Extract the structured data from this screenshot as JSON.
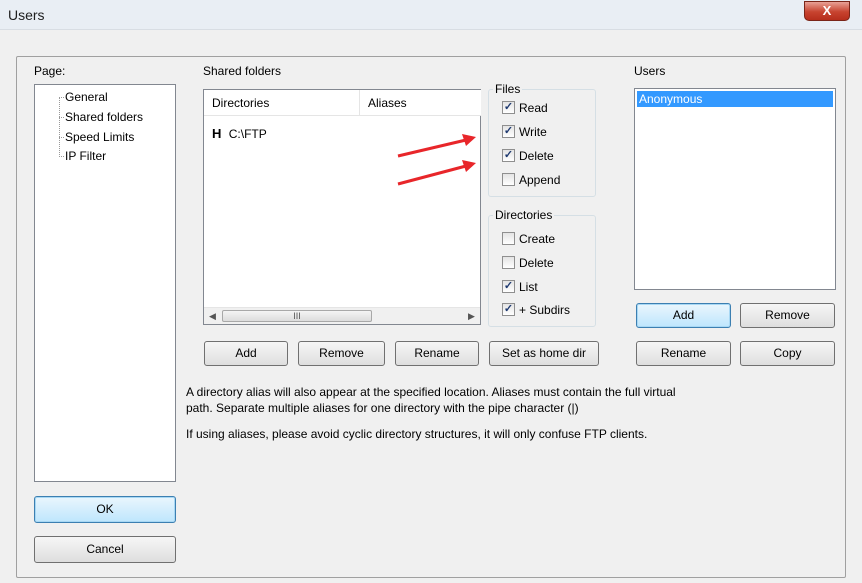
{
  "window": {
    "title": "Users",
    "close_glyph": "X"
  },
  "page_panel": {
    "label": "Page:",
    "items": [
      {
        "label": "General"
      },
      {
        "label": "Shared folders"
      },
      {
        "label": "Speed Limits"
      },
      {
        "label": "IP Filter"
      }
    ]
  },
  "shared_folders": {
    "label": "Shared folders",
    "columns": [
      "Directories",
      "Aliases"
    ],
    "rows": [
      {
        "flag": "H",
        "path": "C:\\FTP",
        "alias": ""
      }
    ],
    "scroll_thumb_glyph": "III",
    "buttons": {
      "add": "Add",
      "remove": "Remove",
      "rename": "Rename",
      "set_home": "Set as home dir"
    }
  },
  "files": {
    "label": "Files",
    "options": [
      {
        "label": "Read",
        "checked": true
      },
      {
        "label": "Write",
        "checked": true
      },
      {
        "label": "Delete",
        "checked": true
      },
      {
        "label": "Append",
        "checked": false
      }
    ]
  },
  "directories": {
    "label": "Directories",
    "options": [
      {
        "label": "Create",
        "checked": false
      },
      {
        "label": "Delete",
        "checked": false
      },
      {
        "label": "List",
        "checked": true
      },
      {
        "label": "+ Subdirs",
        "checked": true
      }
    ]
  },
  "users": {
    "label": "Users",
    "items": [
      {
        "name": "Anonymous",
        "selected": true
      }
    ],
    "buttons": {
      "add": "Add",
      "remove": "Remove",
      "rename": "Rename",
      "copy": "Copy"
    }
  },
  "info": {
    "line1": "A directory alias will also appear at the specified location. Aliases must contain the full virtual",
    "line2": "path. Separate multiple aliases for one directory with the pipe character (|)",
    "line3": "If using aliases, please avoid cyclic directory structures, it will only confuse FTP clients."
  },
  "dialog_buttons": {
    "ok": "OK",
    "cancel": "Cancel"
  },
  "annotation_color": "#e8262a",
  "check_glyph": "✓"
}
